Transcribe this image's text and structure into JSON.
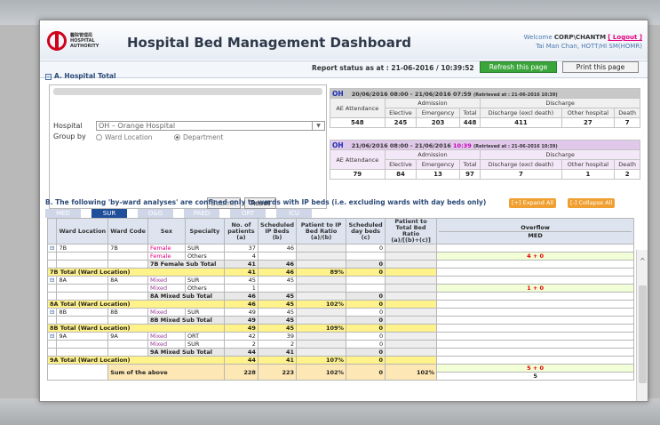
{
  "header": {
    "org": "醫院管理局 HOSPITAL AUTHORITY",
    "title": "Hospital Bed Management Dashboard",
    "welcome_prefix": "Welcome ",
    "user": "CORP\\CHANTM",
    "logout": "[ Logout ]",
    "user_detail": "Tai Man Chan, HOTT/HI SM(HOMR)"
  },
  "status": {
    "report_status": "Report status as at : 21-06-2016 / 10:39:52",
    "refresh": "Refresh this page",
    "print": "Print this page"
  },
  "sectionA": {
    "title": "A. Hospital Total",
    "hospital_label": "Hospital",
    "hospital_value": "OH – Orange Hospital",
    "groupby_label": "Group by",
    "opt_ward": "Ward Location",
    "opt_dept": "Department",
    "submit": "Submit",
    "reset": "Reset"
  },
  "tableA1": {
    "hosp": "OH",
    "period": "20/06/2016 08:00 - 21/06/2016 07:59",
    "retrieved": "(Retrieved at : 21-06-2016 10:39)",
    "admission": "Admission",
    "discharge": "Discharge",
    "ae": "AE Attendance",
    "elective": "Elective",
    "emergency": "Emergency",
    "total": "Total",
    "disch_excl": "Discharge (excl death)",
    "other": "Other hospital",
    "death": "Death",
    "values": [
      "548",
      "245",
      "203",
      "448",
      "411",
      "27",
      "7"
    ]
  },
  "tableA2": {
    "hosp": "OH",
    "period": "21/06/2016 08:00 - 21/06/2016 ",
    "time": "10:39",
    "retrieved": "(Retrieved at : 21-06-2016 10:39)",
    "admission": "Admission",
    "discharge": "Discharge",
    "ae": "AE Attendance",
    "elective": "Elective",
    "emergency": "Emergency",
    "total": "Total",
    "disch_excl": "Discharge (excl death)",
    "other": "Other hospital",
    "death": "Death",
    "values": [
      "79",
      "84",
      "13",
      "97",
      "7",
      "1",
      "2"
    ]
  },
  "sectionB": {
    "title": "B. The following 'by-ward analyses' are confined only to wards with IP beds (i.e. excluding wards with day beds only)",
    "expand": "[+] Expand All",
    "collapse": "[-] Collapse All",
    "tabs": [
      "MED",
      "SUR",
      "O&G",
      "PAED",
      "ORT",
      "ICU"
    ]
  },
  "grid": {
    "headers": {
      "ward_loc": "Ward Location",
      "ward_code": "Ward Code",
      "sex": "Sex",
      "specialty": "Specialty",
      "patients": "No. of patients (a)",
      "ip_beds": "Scheduled IP Beds (b)",
      "ratio": "Patient to IP Bed Ratio (a)/(b)",
      "day_beds": "Scheduled day beds (c)",
      "total_ratio": "Patient to Total Bed Ratio (a)/[(b)+(c)]",
      "overflow": "Overflow",
      "med": "MED"
    },
    "rows": [
      {
        "t": "d",
        "mk": "⊟",
        "loc": "7B",
        "code": "7B",
        "sex": "Female",
        "spec": "SUR",
        "a": "37",
        "b": "46",
        "c": "",
        "d": "0",
        "e": "",
        "ov": ""
      },
      {
        "t": "d",
        "mk": "",
        "loc": "",
        "code": "",
        "sex": "Female",
        "spec": "Others",
        "a": "4",
        "b": "",
        "c": "",
        "d": "",
        "e": "",
        "ov": "4 + 0"
      },
      {
        "t": "s",
        "label": "7B Female Sub Total",
        "a": "41",
        "b": "46",
        "c": "",
        "d": "0"
      },
      {
        "t": "w",
        "label": "7B Total (Ward Location)",
        "a": "41",
        "b": "46",
        "c": "89%",
        "d": "0"
      },
      {
        "t": "d",
        "mk": "⊟",
        "loc": "8A",
        "code": "8A",
        "sex": "Mixed",
        "spec": "SUR",
        "a": "45",
        "b": "45",
        "c": "",
        "d": "",
        "e": "",
        "ov": ""
      },
      {
        "t": "d",
        "mk": "",
        "loc": "",
        "code": "",
        "sex": "Mixed",
        "spec": "Others",
        "a": "1",
        "b": "",
        "c": "",
        "d": "",
        "e": "",
        "ov": "1 + 0"
      },
      {
        "t": "s",
        "label": "8A Mixed Sub Total",
        "a": "46",
        "b": "45",
        "c": "",
        "d": "0"
      },
      {
        "t": "w",
        "label": "8A Total (Ward Location)",
        "a": "46",
        "b": "45",
        "c": "102%",
        "d": "0"
      },
      {
        "t": "d",
        "mk": "⊟",
        "loc": "8B",
        "code": "8B",
        "sex": "Mixed",
        "spec": "SUR",
        "a": "49",
        "b": "45",
        "c": "",
        "d": "0",
        "e": "",
        "ov": ""
      },
      {
        "t": "s",
        "label": "8B Mixed Sub Total",
        "a": "49",
        "b": "45",
        "c": "",
        "d": "0"
      },
      {
        "t": "w",
        "label": "8B Total (Ward Location)",
        "a": "49",
        "b": "45",
        "c": "109%",
        "d": "0"
      },
      {
        "t": "d",
        "mk": "⊟",
        "loc": "9A",
        "code": "9A",
        "sex": "Mixed",
        "spec": "ORT",
        "a": "42",
        "b": "39",
        "c": "",
        "d": "0",
        "e": "",
        "ov": ""
      },
      {
        "t": "d",
        "mk": "",
        "loc": "",
        "code": "",
        "sex": "Mixed",
        "spec": "SUR",
        "a": "2",
        "b": "2",
        "c": "",
        "d": "0",
        "e": "",
        "ov": ""
      },
      {
        "t": "s",
        "label": "9A Mixed Sub Total",
        "a": "44",
        "b": "41",
        "c": "",
        "d": "0"
      },
      {
        "t": "w",
        "label": "9A Total (Ward Location)",
        "a": "44",
        "b": "41",
        "c": "107%",
        "d": "0"
      }
    ],
    "sum": {
      "label": "Sum of the above",
      "a": "228",
      "b": "223",
      "c": "102%",
      "d": "0",
      "e": "102%",
      "ov1": "5 + 0",
      "ov2": "5"
    }
  }
}
